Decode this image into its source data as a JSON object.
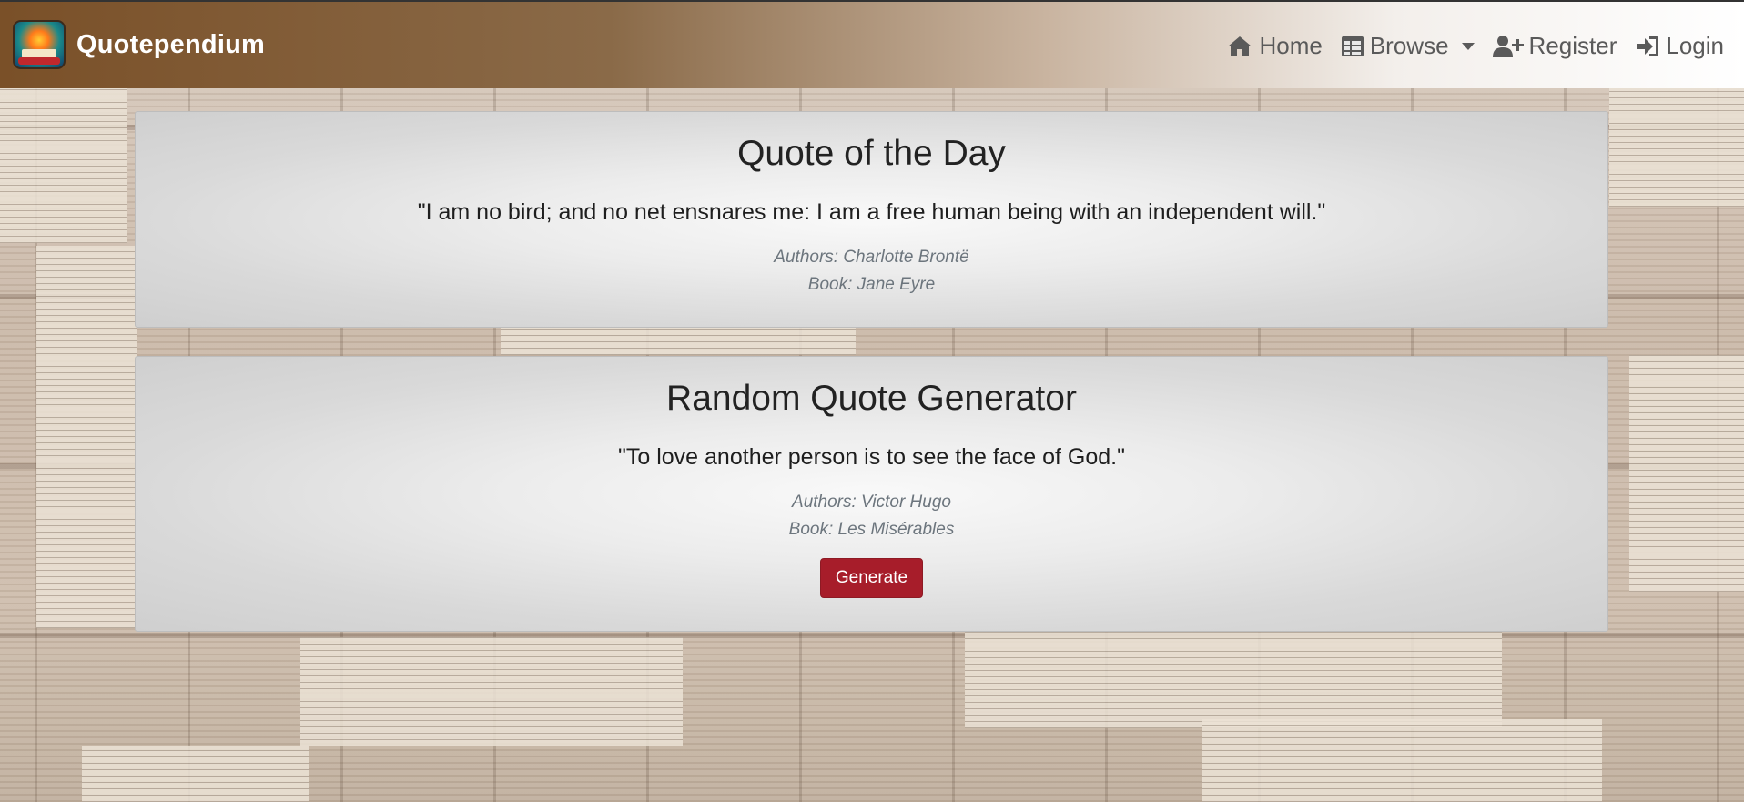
{
  "navbar": {
    "brand": "Quotependium",
    "logo_icon": "book-sun-logo-icon",
    "items": [
      {
        "label": "Home",
        "icon": "home-icon"
      },
      {
        "label": "Browse",
        "icon": "table-icon",
        "dropdown": true
      },
      {
        "label": "Register",
        "icon": "user-plus-icon"
      },
      {
        "label": "Login",
        "icon": "sign-in-icon"
      }
    ]
  },
  "quote_of_the_day": {
    "title": "Quote of the Day",
    "quote": "\"I am no bird; and no net ensnares me: I am a free human being with an independent will.\"",
    "authors": "Authors: Charlotte Brontë",
    "book": "Book: Jane Eyre"
  },
  "random_quote": {
    "title": "Random Quote Generator",
    "quote": "\"To love another person is to see the face of God.\"",
    "authors": "Authors: Victor Hugo",
    "book": "Book: Les Misérables",
    "button_label": "Generate",
    "button_color": "#a71d2a"
  }
}
